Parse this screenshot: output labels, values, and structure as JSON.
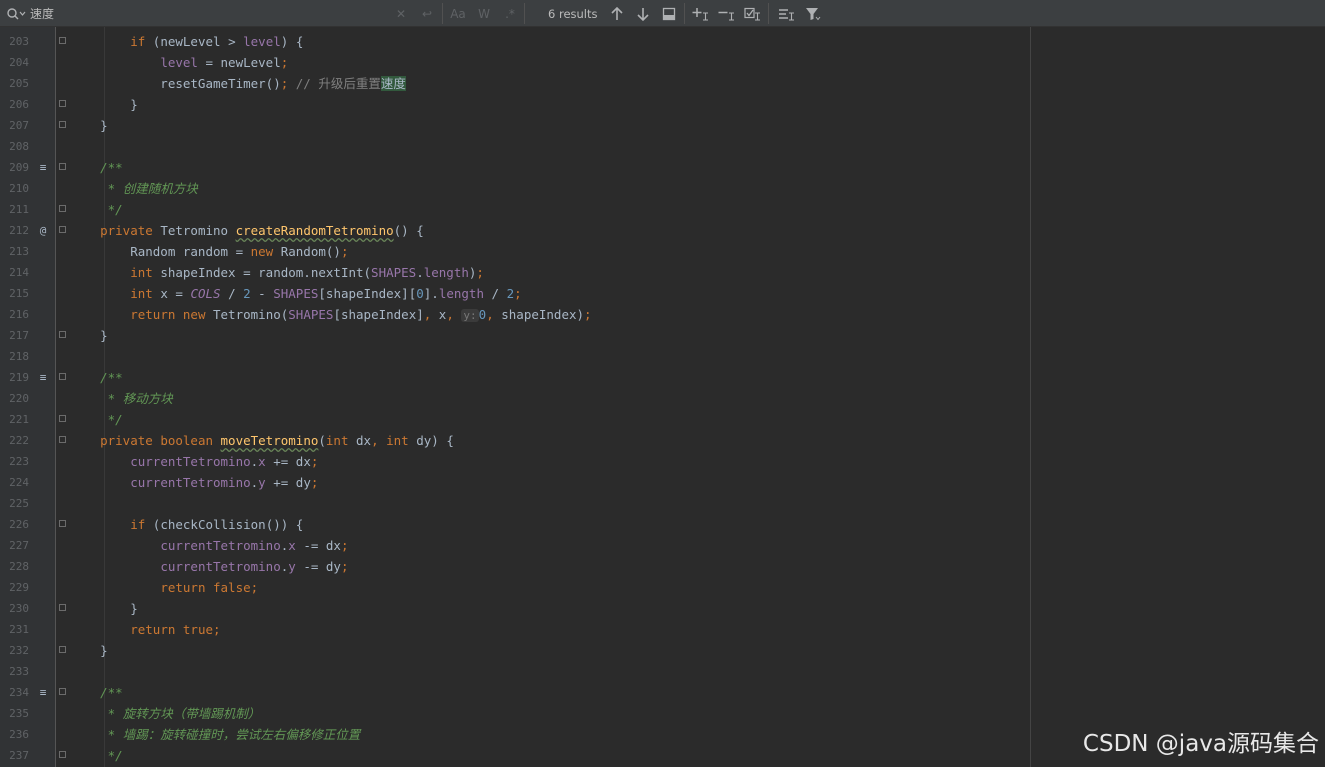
{
  "search": {
    "value": "速度",
    "results": "6 results"
  },
  "toolbar": {
    "match_case": "Aa",
    "words": "W",
    "regex": ".*"
  },
  "watermark": "CSDN @java源码集合",
  "colors": {
    "keyword": "#cc7832",
    "field": "#9876aa",
    "function": "#ffc66d",
    "number": "#6897bb",
    "doc_comment": "#629755",
    "comment": "#808080",
    "search_highlight": "#32593d"
  },
  "lines": [
    {
      "n": "203",
      "fold": true,
      "code": [
        [
          "        ",
          ""
        ],
        [
          "if",
          "kw"
        ],
        [
          " (newLevel > ",
          ""
        ],
        [
          "level",
          "fld"
        ],
        [
          ") {",
          ""
        ]
      ]
    },
    {
      "n": "204",
      "code": [
        [
          "            ",
          ""
        ],
        [
          "level",
          "fld"
        ],
        [
          " = newLevel",
          ""
        ],
        [
          ";",
          "kw"
        ]
      ]
    },
    {
      "n": "205",
      "code": [
        [
          "            resetGameTimer()",
          ""
        ],
        [
          ";",
          "kw"
        ],
        [
          " ",
          ""
        ],
        [
          "// 升级后重置",
          "cm"
        ],
        [
          "速度",
          "hl"
        ]
      ]
    },
    {
      "n": "206",
      "fold": true,
      "code": [
        [
          "        }",
          ""
        ]
      ]
    },
    {
      "n": "207",
      "fold": true,
      "code": [
        [
          "    }",
          ""
        ]
      ]
    },
    {
      "n": "208",
      "code": []
    },
    {
      "n": "209",
      "fold": true,
      "mark": "≡",
      "code": [
        [
          "    ",
          ""
        ],
        [
          "/**",
          "doc"
        ]
      ]
    },
    {
      "n": "210",
      "code": [
        [
          "     ",
          ""
        ],
        [
          "* 创建随机方块",
          "doc"
        ]
      ]
    },
    {
      "n": "211",
      "fold": true,
      "code": [
        [
          "     ",
          ""
        ],
        [
          "*/",
          "doc"
        ]
      ]
    },
    {
      "n": "212",
      "fold": true,
      "mark": "@",
      "code": [
        [
          "    ",
          ""
        ],
        [
          "private",
          "kw"
        ],
        [
          " Tetromino ",
          ""
        ],
        [
          "createRandomTetromino",
          "fn wavy"
        ],
        [
          "() {",
          ""
        ]
      ]
    },
    {
      "n": "213",
      "code": [
        [
          "        Random random = ",
          ""
        ],
        [
          "new",
          "kw"
        ],
        [
          " Random()",
          ""
        ],
        [
          ";",
          "kw"
        ]
      ]
    },
    {
      "n": "214",
      "code": [
        [
          "        ",
          ""
        ],
        [
          "int",
          "kw"
        ],
        [
          " shapeIndex = random.nextInt(",
          ""
        ],
        [
          "SHAPES",
          "fld"
        ],
        [
          ".",
          ""
        ],
        [
          "length",
          "fld"
        ],
        [
          ")",
          ""
        ],
        [
          ";",
          "kw"
        ]
      ]
    },
    {
      "n": "215",
      "code": [
        [
          "        ",
          ""
        ],
        [
          "int",
          "kw"
        ],
        [
          " x = ",
          ""
        ],
        [
          "COLS",
          "cfi"
        ],
        [
          " / ",
          ""
        ],
        [
          "2",
          "num"
        ],
        [
          " - ",
          ""
        ],
        [
          "SHAPES",
          "fld"
        ],
        [
          "[shapeIndex][",
          ""
        ],
        [
          "0",
          "num"
        ],
        [
          "].",
          ""
        ],
        [
          "length",
          "fld"
        ],
        [
          " / ",
          ""
        ],
        [
          "2",
          "num"
        ],
        [
          ";",
          "kw"
        ]
      ]
    },
    {
      "n": "216",
      "code": [
        [
          "        ",
          ""
        ],
        [
          "return",
          "kw"
        ],
        [
          " ",
          ""
        ],
        [
          "new",
          "kw"
        ],
        [
          " Tetromino(",
          ""
        ],
        [
          "SHAPES",
          "fld"
        ],
        [
          "[shapeIndex]",
          ""
        ],
        [
          ",",
          "kw"
        ],
        [
          " x",
          ""
        ],
        [
          ",",
          "kw"
        ],
        [
          " ",
          ""
        ],
        [
          "y:",
          "hint"
        ],
        [
          "0",
          "num"
        ],
        [
          ",",
          "kw"
        ],
        [
          " shapeIndex)",
          ""
        ],
        [
          ";",
          "kw"
        ]
      ]
    },
    {
      "n": "217",
      "fold": true,
      "code": [
        [
          "    }",
          ""
        ]
      ]
    },
    {
      "n": "218",
      "code": []
    },
    {
      "n": "219",
      "fold": true,
      "mark": "≡",
      "code": [
        [
          "    ",
          ""
        ],
        [
          "/**",
          "doc"
        ]
      ]
    },
    {
      "n": "220",
      "code": [
        [
          "     ",
          ""
        ],
        [
          "* 移动方块",
          "doc"
        ]
      ]
    },
    {
      "n": "221",
      "fold": true,
      "code": [
        [
          "     ",
          ""
        ],
        [
          "*/",
          "doc"
        ]
      ]
    },
    {
      "n": "222",
      "fold": true,
      "code": [
        [
          "    ",
          ""
        ],
        [
          "private boolean",
          "kw"
        ],
        [
          " ",
          ""
        ],
        [
          "moveTetromino",
          "fn wavy"
        ],
        [
          "(",
          ""
        ],
        [
          "int",
          "kw"
        ],
        [
          " dx",
          ""
        ],
        [
          ",",
          "kw"
        ],
        [
          " ",
          ""
        ],
        [
          "int",
          "kw"
        ],
        [
          " dy) {",
          ""
        ]
      ]
    },
    {
      "n": "223",
      "code": [
        [
          "        ",
          ""
        ],
        [
          "currentTetromino",
          "fld"
        ],
        [
          ".",
          ""
        ],
        [
          "x",
          "fld"
        ],
        [
          " += dx",
          ""
        ],
        [
          ";",
          "kw"
        ]
      ]
    },
    {
      "n": "224",
      "code": [
        [
          "        ",
          ""
        ],
        [
          "currentTetromino",
          "fld"
        ],
        [
          ".",
          ""
        ],
        [
          "y",
          "fld"
        ],
        [
          " += dy",
          ""
        ],
        [
          ";",
          "kw"
        ]
      ]
    },
    {
      "n": "225",
      "code": []
    },
    {
      "n": "226",
      "fold": true,
      "code": [
        [
          "        ",
          ""
        ],
        [
          "if",
          "kw"
        ],
        [
          " (checkCollision()) {",
          ""
        ]
      ]
    },
    {
      "n": "227",
      "code": [
        [
          "            ",
          ""
        ],
        [
          "currentTetromino",
          "fld"
        ],
        [
          ".",
          ""
        ],
        [
          "x",
          "fld"
        ],
        [
          " -= dx",
          ""
        ],
        [
          ";",
          "kw"
        ]
      ]
    },
    {
      "n": "228",
      "code": [
        [
          "            ",
          ""
        ],
        [
          "currentTetromino",
          "fld"
        ],
        [
          ".",
          ""
        ],
        [
          "y",
          "fld"
        ],
        [
          " -= dy",
          ""
        ],
        [
          ";",
          "kw"
        ]
      ]
    },
    {
      "n": "229",
      "code": [
        [
          "            ",
          ""
        ],
        [
          "return false;",
          "kw"
        ]
      ]
    },
    {
      "n": "230",
      "fold": true,
      "code": [
        [
          "        }",
          ""
        ]
      ]
    },
    {
      "n": "231",
      "code": [
        [
          "        ",
          ""
        ],
        [
          "return true;",
          "kw"
        ]
      ]
    },
    {
      "n": "232",
      "fold": true,
      "code": [
        [
          "    }",
          ""
        ]
      ]
    },
    {
      "n": "233",
      "code": []
    },
    {
      "n": "234",
      "fold": true,
      "mark": "≡",
      "code": [
        [
          "    ",
          ""
        ],
        [
          "/**",
          "doc"
        ]
      ]
    },
    {
      "n": "235",
      "code": [
        [
          "     ",
          ""
        ],
        [
          "* 旋转方块（带墙踢机制）",
          "doc"
        ]
      ]
    },
    {
      "n": "236",
      "code": [
        [
          "     ",
          ""
        ],
        [
          "* 墙踢：旋转碰撞时，尝试左右偏移修正位置",
          "doc"
        ]
      ]
    },
    {
      "n": "237",
      "fold": true,
      "code": [
        [
          "     ",
          ""
        ],
        [
          "*/",
          "doc"
        ]
      ]
    }
  ]
}
